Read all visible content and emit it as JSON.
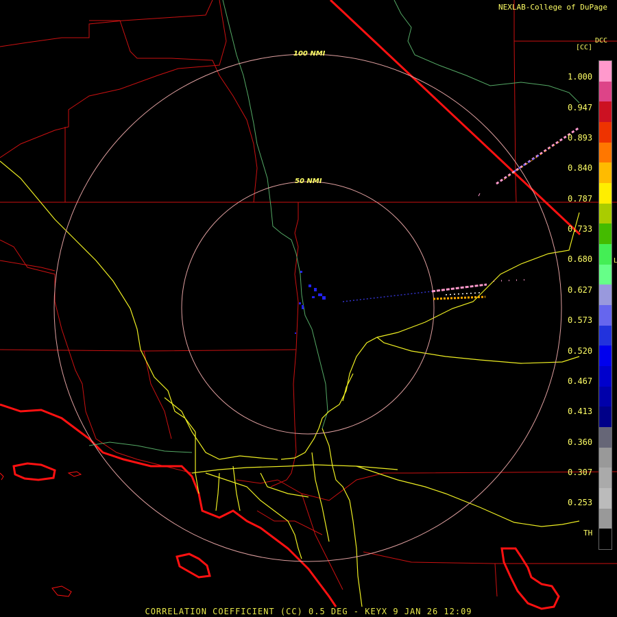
{
  "header": {
    "credit": "NEXLAB-College of DuPage",
    "station_id": "DCC",
    "product_unit": "[CC]"
  },
  "footer": {
    "title": "CORRELATION COEFFICIENT (CC) 0.5 DEG - KEYX 9 JAN 26 12:09"
  },
  "range_rings": [
    {
      "label": "50 NMI",
      "radius_nmi": 50
    },
    {
      "label": "100 NMI",
      "radius_nmi": 100
    }
  ],
  "colorbar": {
    "ticks": [
      "1.000",
      "0.947",
      "0.893",
      "0.840",
      "0.787",
      "0.733",
      "0.680",
      "0.627",
      "0.573",
      "0.520",
      "0.467",
      "0.413",
      "0.360",
      "0.307",
      "0.253"
    ],
    "threshold_label": "TH",
    "colors": [
      "#ff99cc",
      "#dd4488",
      "#cc1122",
      "#ee3300",
      "#ff7700",
      "#ffbb00",
      "#ffee00",
      "#aacc00",
      "#44bb00",
      "#44ee55",
      "#66ff88",
      "#9999dd",
      "#6666ee",
      "#2233dd",
      "#0000ee",
      "#0000cc",
      "#0000aa",
      "#000088",
      "#666677",
      "#999999",
      "#aaaaaa",
      "#bbbbbb",
      "#999999",
      "#000000"
    ],
    "marker": "L"
  },
  "map_colors": {
    "boundaries": "#dd1111",
    "coast": "#ff1111",
    "rivers": "#66aa66",
    "highways": "#ffff33",
    "rings": "#e0a0a0"
  }
}
